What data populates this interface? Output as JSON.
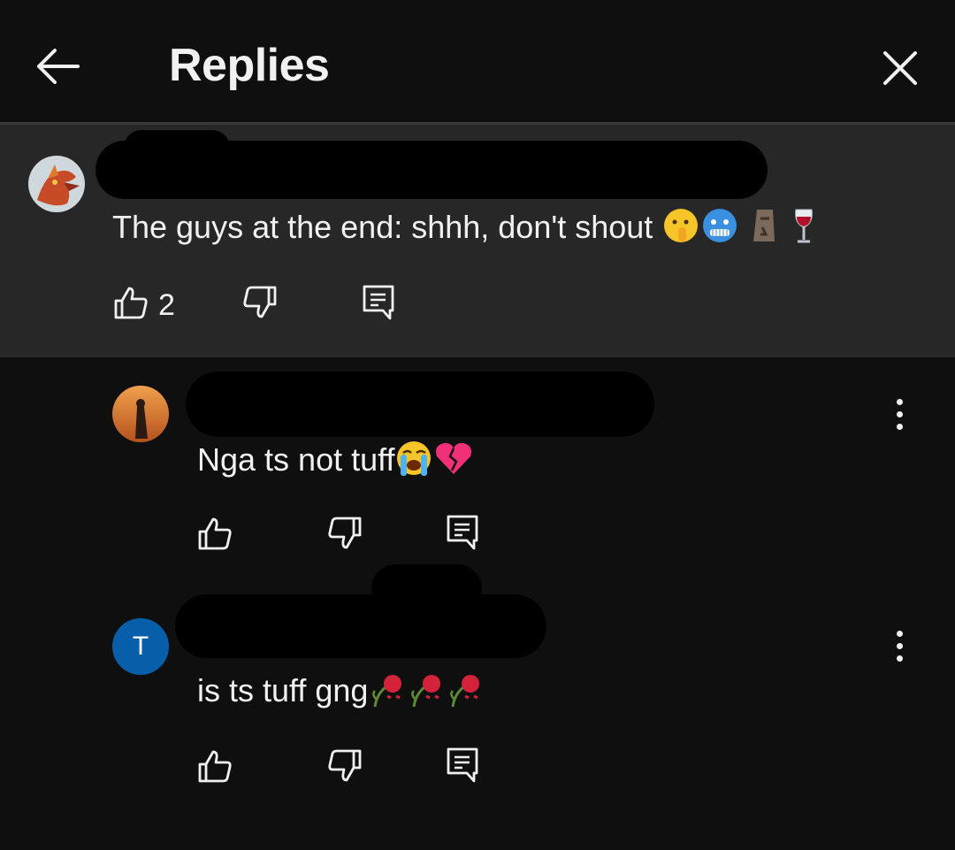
{
  "header": {
    "title": "Replies",
    "back_icon": "arrow-left-icon",
    "close_icon": "close-icon"
  },
  "parent_comment": {
    "text": "The guys at the end: shhh, don't shout",
    "emojis": [
      "shushing-face",
      "cold-face",
      "moai",
      "wine-glass"
    ],
    "like_count": "2"
  },
  "replies": [
    {
      "text": "Nga ts not tuff",
      "emojis": [
        "loudly-crying-face",
        "broken-heart"
      ]
    },
    {
      "avatar_letter": "T",
      "text": "is ts tuff gng",
      "emojis": [
        "wilted-flower",
        "wilted-flower",
        "wilted-flower"
      ]
    }
  ],
  "colors": {
    "background": "#0f0f0f",
    "parent_background": "#272727",
    "avatar_blue": "#065fa8",
    "text": "#f1f1f1"
  }
}
